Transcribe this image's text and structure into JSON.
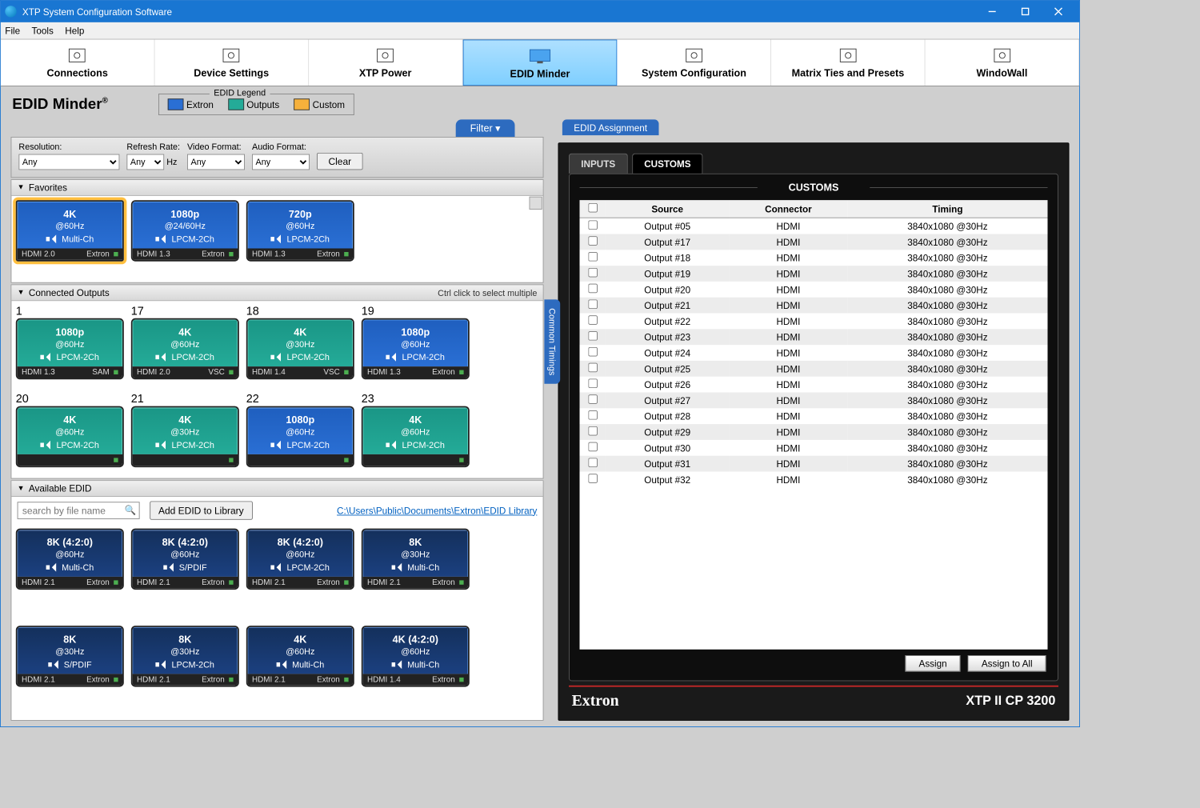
{
  "window": {
    "title": "XTP System Configuration Software"
  },
  "menubar": [
    "File",
    "Tools",
    "Help"
  ],
  "toolbar": [
    {
      "label": "Connections"
    },
    {
      "label": "Device Settings"
    },
    {
      "label": "XTP Power"
    },
    {
      "label": "EDID Minder",
      "active": true
    },
    {
      "label": "System Configuration"
    },
    {
      "label": "Matrix Ties and Presets"
    },
    {
      "label": "WindoWall"
    }
  ],
  "page": {
    "title": "EDID Minder",
    "sup": "®"
  },
  "legend": {
    "title": "EDID Legend",
    "items": [
      {
        "label": "Extron",
        "color": "#2a6fd4"
      },
      {
        "label": "Outputs",
        "color": "#24ab98"
      },
      {
        "label": "Custom",
        "color": "#f6b13c"
      }
    ]
  },
  "filter": {
    "tab": "Filter ▾",
    "resolution_label": "Resolution:",
    "resolution": "Any",
    "refresh_label": "Refresh Rate:",
    "refresh": "Any",
    "hz": "Hz",
    "video_label": "Video Format:",
    "video": "Any",
    "audio_label": "Audio Format:",
    "audio": "Any",
    "clear": "Clear"
  },
  "sections": {
    "favorites": {
      "title": "Favorites",
      "cards": [
        {
          "c": "blue",
          "fav": true,
          "res": "4K",
          "rate": "@60Hz",
          "aud": "Multi-Ch",
          "l": "HDMI 2.0",
          "r": "Extron"
        },
        {
          "c": "blue",
          "res": "1080p",
          "rate": "@24/60Hz",
          "aud": "LPCM-2Ch",
          "l": "HDMI 1.3",
          "r": "Extron"
        },
        {
          "c": "blue",
          "res": "720p",
          "rate": "@60Hz",
          "aud": "LPCM-2Ch",
          "l": "HDMI 1.3",
          "r": "Extron"
        }
      ]
    },
    "outputs": {
      "title": "Connected Outputs",
      "hint": "Ctrl click to select multiple",
      "cards": [
        {
          "n": "1",
          "c": "teal",
          "res": "1080p",
          "rate": "@60Hz",
          "aud": "LPCM-2Ch",
          "l": "HDMI 1.3",
          "r": "SAM"
        },
        {
          "n": "17",
          "c": "teal",
          "res": "4K",
          "rate": "@60Hz",
          "aud": "LPCM-2Ch",
          "l": "HDMI 2.0",
          "r": "VSC"
        },
        {
          "n": "18",
          "c": "teal",
          "res": "4K",
          "rate": "@30Hz",
          "aud": "LPCM-2Ch",
          "l": "HDMI 1.4",
          "r": "VSC"
        },
        {
          "n": "19",
          "c": "blue",
          "res": "1080p",
          "rate": "@60Hz",
          "aud": "LPCM-2Ch",
          "l": "HDMI 1.3",
          "r": "Extron"
        },
        {
          "n": "20",
          "c": "teal",
          "res": "4K",
          "rate": "@60Hz",
          "aud": "LPCM-2Ch",
          "l": "",
          "r": ""
        },
        {
          "n": "21",
          "c": "teal",
          "res": "4K",
          "rate": "@30Hz",
          "aud": "LPCM-2Ch",
          "l": "",
          "r": ""
        },
        {
          "n": "22",
          "c": "blue",
          "res": "1080p",
          "rate": "@60Hz",
          "aud": "LPCM-2Ch",
          "l": "",
          "r": ""
        },
        {
          "n": "23",
          "c": "teal",
          "res": "4K",
          "rate": "@60Hz",
          "aud": "LPCM-2Ch",
          "l": "",
          "r": ""
        }
      ]
    },
    "available": {
      "title": "Available EDID",
      "search_placeholder": "search by file name",
      "add_btn": "Add EDID to Library",
      "path": "C:\\Users\\Public\\Documents\\Extron\\EDID Library",
      "cards": [
        {
          "c": "dark",
          "res": "8K (4:2:0)",
          "rate": "@60Hz",
          "aud": "Multi-Ch",
          "l": "HDMI 2.1",
          "r": "Extron"
        },
        {
          "c": "dark",
          "res": "8K (4:2:0)",
          "rate": "@60Hz",
          "aud": "S/PDIF",
          "l": "HDMI 2.1",
          "r": "Extron"
        },
        {
          "c": "dark",
          "res": "8K (4:2:0)",
          "rate": "@60Hz",
          "aud": "LPCM-2Ch",
          "l": "HDMI 2.1",
          "r": "Extron"
        },
        {
          "c": "dark",
          "res": "8K",
          "rate": "@30Hz",
          "aud": "Multi-Ch",
          "l": "HDMI 2.1",
          "r": "Extron"
        },
        {
          "c": "dark",
          "res": "8K",
          "rate": "@30Hz",
          "aud": "S/PDIF",
          "l": "HDMI 2.1",
          "r": "Extron"
        },
        {
          "c": "dark",
          "res": "8K",
          "rate": "@30Hz",
          "aud": "LPCM-2Ch",
          "l": "HDMI 2.1",
          "r": "Extron"
        },
        {
          "c": "dark",
          "res": "4K",
          "rate": "@60Hz",
          "aud": "Multi-Ch",
          "l": "HDMI 2.1",
          "r": "Extron"
        },
        {
          "c": "dark",
          "res": "4K (4:2:0)",
          "rate": "@60Hz",
          "aud": "Multi-Ch",
          "l": "HDMI 1.4",
          "r": "Extron"
        }
      ]
    }
  },
  "common_timings": "Common Timings",
  "assignment": {
    "tab": "EDID Assignment",
    "inputs_tab": "INPUTS",
    "customs_tab": "CUSTOMS",
    "customs_title": "CUSTOMS",
    "headers": {
      "source": "Source",
      "connector": "Connector",
      "timing": "Timing"
    },
    "rows": [
      {
        "src": "Output #05",
        "con": "HDMI",
        "tim": "3840x1080 @30Hz"
      },
      {
        "src": "Output #17",
        "con": "HDMI",
        "tim": "3840x1080 @30Hz"
      },
      {
        "src": "Output #18",
        "con": "HDMI",
        "tim": "3840x1080 @30Hz"
      },
      {
        "src": "Output #19",
        "con": "HDMI",
        "tim": "3840x1080 @30Hz"
      },
      {
        "src": "Output #20",
        "con": "HDMI",
        "tim": "3840x1080 @30Hz"
      },
      {
        "src": "Output #21",
        "con": "HDMI",
        "tim": "3840x1080 @30Hz"
      },
      {
        "src": "Output #22",
        "con": "HDMI",
        "tim": "3840x1080 @30Hz"
      },
      {
        "src": "Output #23",
        "con": "HDMI",
        "tim": "3840x1080 @30Hz"
      },
      {
        "src": "Output #24",
        "con": "HDMI",
        "tim": "3840x1080 @30Hz"
      },
      {
        "src": "Output #25",
        "con": "HDMI",
        "tim": "3840x1080 @30Hz"
      },
      {
        "src": "Output #26",
        "con": "HDMI",
        "tim": "3840x1080 @30Hz"
      },
      {
        "src": "Output #27",
        "con": "HDMI",
        "tim": "3840x1080 @30Hz"
      },
      {
        "src": "Output #28",
        "con": "HDMI",
        "tim": "3840x1080 @30Hz"
      },
      {
        "src": "Output #29",
        "con": "HDMI",
        "tim": "3840x1080 @30Hz"
      },
      {
        "src": "Output #30",
        "con": "HDMI",
        "tim": "3840x1080 @30Hz"
      },
      {
        "src": "Output #31",
        "con": "HDMI",
        "tim": "3840x1080 @30Hz"
      },
      {
        "src": "Output #32",
        "con": "HDMI",
        "tim": "3840x1080 @30Hz"
      }
    ],
    "assign": "Assign",
    "assign_all": "Assign to All",
    "brand": "Extron",
    "model": "XTP II CP 3200"
  }
}
